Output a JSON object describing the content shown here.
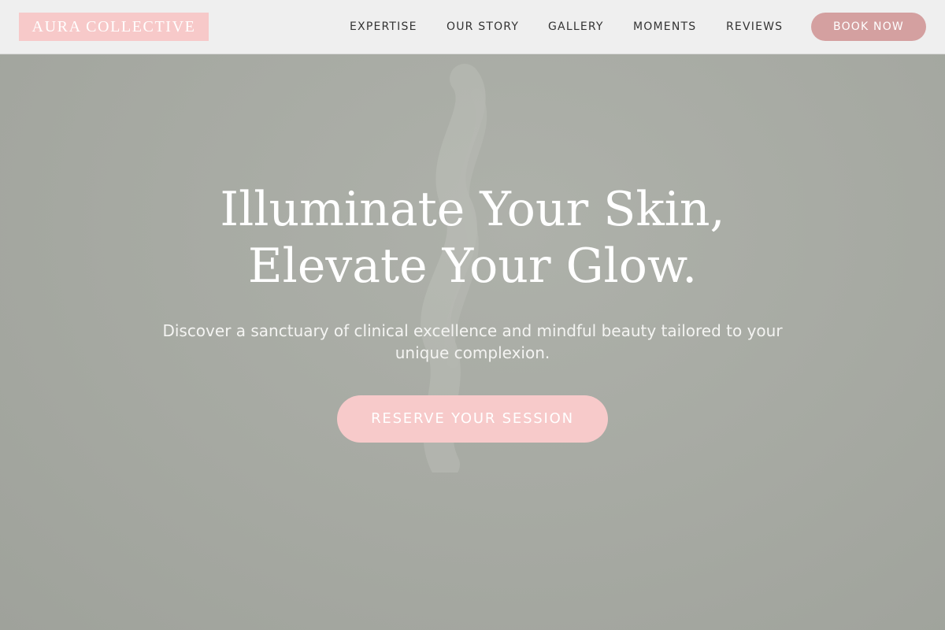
{
  "header": {
    "logo_text": "AURA COLLECTIVE",
    "nav": [
      {
        "label": "EXPERTISE"
      },
      {
        "label": "OUR STORY"
      },
      {
        "label": "GALLERY"
      },
      {
        "label": "MOMENTS"
      },
      {
        "label": "REVIEWS"
      }
    ],
    "book_label": "BOOK NOW"
  },
  "hero": {
    "title_line1": "Illuminate Your Skin,",
    "title_line2": "Elevate Your Glow.",
    "subtitle": "Discover a sanctuary of clinical excellence and mindful beauty tailored to your unique complexion.",
    "cta_label": "RESERVE YOUR SESSION"
  },
  "colors": {
    "header_bg": "#efefef",
    "logo_bg": "#f7c9c9",
    "book_button_bg": "#d4a0a0",
    "hero_bg": "#a7aaa3",
    "cta_bg": "#f7caca",
    "nav_text": "#333333"
  }
}
